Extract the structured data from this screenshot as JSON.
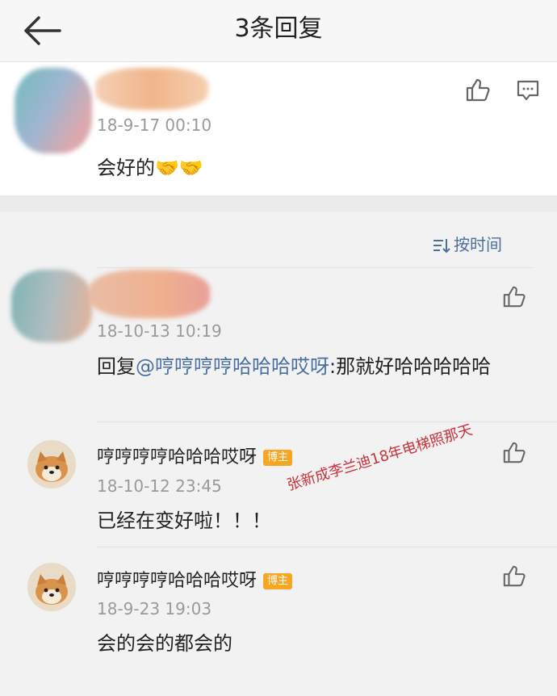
{
  "header": {
    "title": "3条回复"
  },
  "post": {
    "time": "18-9-17 00:10",
    "text": "会好的🤝🤝"
  },
  "sort": {
    "label": "按时间"
  },
  "replies": [
    {
      "time": "18-10-13 10:19",
      "prefix": "回复",
      "mention": "@哼哼哼哼哈哈哈哎呀",
      "text": ":那就好哈哈哈哈哈"
    },
    {
      "name": "哼哼哼哼哈哈哈哎呀",
      "badge": "博主",
      "time": "18-10-12 23:45",
      "text": "已经在变好啦！！！"
    },
    {
      "name": "哼哼哼哼哈哈哈哎呀",
      "badge": "博主",
      "time": "18-9-23 19:03",
      "text": "会的会的都会的"
    }
  ],
  "watermark": "张新成李兰迪18年电梯照那天",
  "icons": [
    "back-arrow-icon",
    "thumbs-up-icon",
    "comment-icon",
    "sort-icon"
  ]
}
